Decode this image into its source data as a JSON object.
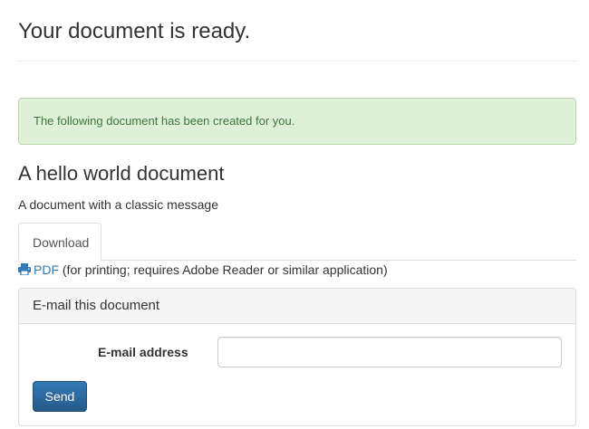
{
  "page": {
    "title": "Your document is ready."
  },
  "alert": {
    "text": "The following document has been created for you.",
    "color": "#3c763d",
    "background": "#dff0d8"
  },
  "document": {
    "title": "A hello world document",
    "description": "A document with a classic message"
  },
  "tabs": [
    {
      "label": "Download",
      "active": true
    }
  ],
  "download": {
    "icon": "printer-icon",
    "link_label": "PDF",
    "note": "(for printing; requires Adobe Reader or similar application)",
    "link_color": "#337ab7"
  },
  "email_panel": {
    "title": "E-mail this document",
    "field_label": "E-mail address",
    "field_value": "",
    "send_label": "Send",
    "button_color": "#337ab7"
  }
}
